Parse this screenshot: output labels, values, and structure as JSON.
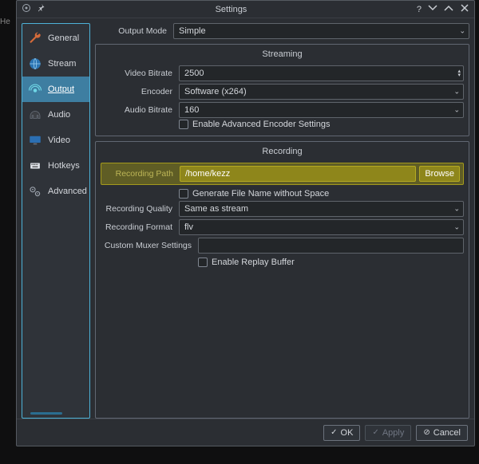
{
  "bg_text": "He",
  "titlebar": {
    "title": "Settings"
  },
  "sidebar": {
    "items": [
      {
        "label": "General"
      },
      {
        "label": "Stream"
      },
      {
        "label": "Output"
      },
      {
        "label": "Audio"
      },
      {
        "label": "Video"
      },
      {
        "label": "Hotkeys"
      },
      {
        "label": "Advanced"
      }
    ]
  },
  "output_mode": {
    "label": "Output Mode",
    "value": "Simple"
  },
  "streaming": {
    "title": "Streaming",
    "video_bitrate": {
      "label": "Video Bitrate",
      "value": "2500"
    },
    "encoder": {
      "label": "Encoder",
      "value": "Software (x264)"
    },
    "audio_bitrate": {
      "label": "Audio Bitrate",
      "value": "160"
    },
    "advanced_check": "Enable Advanced Encoder Settings"
  },
  "recording": {
    "title": "Recording",
    "path": {
      "label": "Recording Path",
      "value": "/home/kezz",
      "browse": "Browse"
    },
    "no_space_check": "Generate File Name without Space",
    "quality": {
      "label": "Recording Quality",
      "value": "Same as stream"
    },
    "format": {
      "label": "Recording Format",
      "value": "flv"
    },
    "muxer": {
      "label": "Custom Muxer Settings",
      "value": ""
    },
    "replay_check": "Enable Replay Buffer"
  },
  "footer": {
    "ok": "OK",
    "apply": "Apply",
    "cancel": "Cancel"
  }
}
